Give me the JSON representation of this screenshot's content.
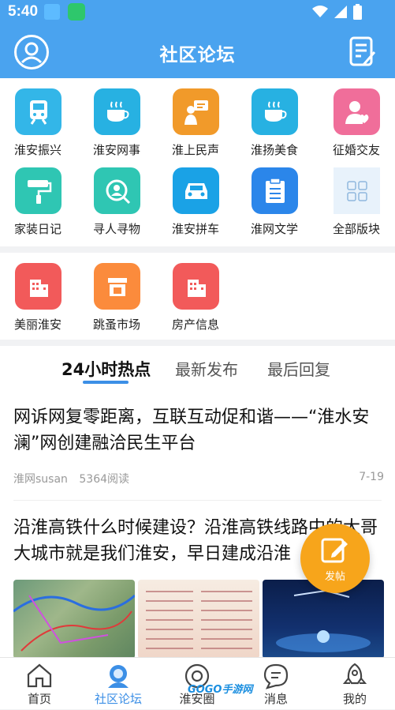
{
  "status_bar": {
    "time": "5:40"
  },
  "header": {
    "title": "社区论坛"
  },
  "categories_row1": [
    {
      "label": "淮安振兴",
      "color": "#33b6e8",
      "icon": "train-icon"
    },
    {
      "label": "淮安网事",
      "color": "#27b1e2",
      "icon": "coffee-icon"
    },
    {
      "label": "淮上民声",
      "color": "#f19a2a",
      "icon": "speaker-person-icon"
    },
    {
      "label": "淮扬美食",
      "color": "#27b1e2",
      "icon": "coffee-icon"
    },
    {
      "label": "征婚交友",
      "color": "#f06e9a",
      "icon": "person-heart-icon"
    }
  ],
  "categories_row2": [
    {
      "label": "家装日记",
      "color": "#2fc6b3",
      "icon": "paint-roller-icon"
    },
    {
      "label": "寻人寻物",
      "color": "#2fc6b3",
      "icon": "search-person-icon"
    },
    {
      "label": "淮安拼车",
      "color": "#1aa2e6",
      "icon": "car-icon"
    },
    {
      "label": "淮网文学",
      "color": "#2b86ea",
      "icon": "document-list-icon"
    },
    {
      "label": "全部版块",
      "color": "#e8f2fb",
      "icon": "grid-icon"
    }
  ],
  "categories_row3": [
    {
      "label": "美丽淮安",
      "color": "#f25a5a",
      "icon": "building-icon"
    },
    {
      "label": "跳蚤市场",
      "color": "#fb8b3c",
      "icon": "shop-icon"
    },
    {
      "label": "房产信息",
      "color": "#f25a5a",
      "icon": "building-icon"
    }
  ],
  "tabs": [
    "24小时热点",
    "最新发布",
    "最后回复"
  ],
  "posts": [
    {
      "title": "网诉网复零距离，互联互动促和谐——“淮水安澜”网创建融洽民生平台",
      "author": "淮网susan",
      "reads": "5364阅读",
      "date": "7-19"
    },
    {
      "title": "沿淮高铁什么时候建设？沿淮高铁线路中的大哥大城市就是我们淮安，早日建成沿淮"
    }
  ],
  "fab": {
    "label": "发帖"
  },
  "bottom_nav": [
    "首页",
    "社区论坛",
    "淮安圈",
    "消息",
    "我的"
  ],
  "watermark": "GOGO手游网"
}
